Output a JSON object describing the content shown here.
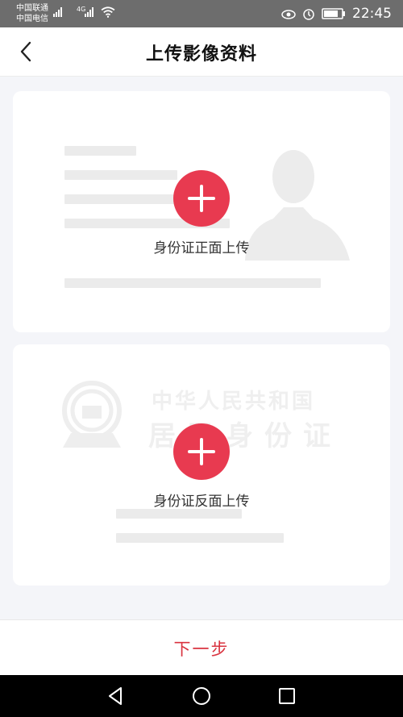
{
  "status_bar": {
    "carrier_1": "中国联通",
    "carrier_2": "中国电信",
    "network": "4G",
    "time": "22:45"
  },
  "header": {
    "title": "上传影像资料",
    "back_icon": "chevron-left-icon"
  },
  "front_card": {
    "label": "身份证正面上传",
    "icon": "plus-icon"
  },
  "back_card": {
    "label": "身份证反面上传",
    "icon": "plus-icon",
    "watermark_line1": "中华人民共和国",
    "watermark_line2": "居民身份证"
  },
  "footer": {
    "next_label": "下一步"
  },
  "colors": {
    "accent": "#e83a50",
    "next_text": "#d9333f",
    "background": "#f4f5f9",
    "placeholder": "#ebebeb"
  }
}
